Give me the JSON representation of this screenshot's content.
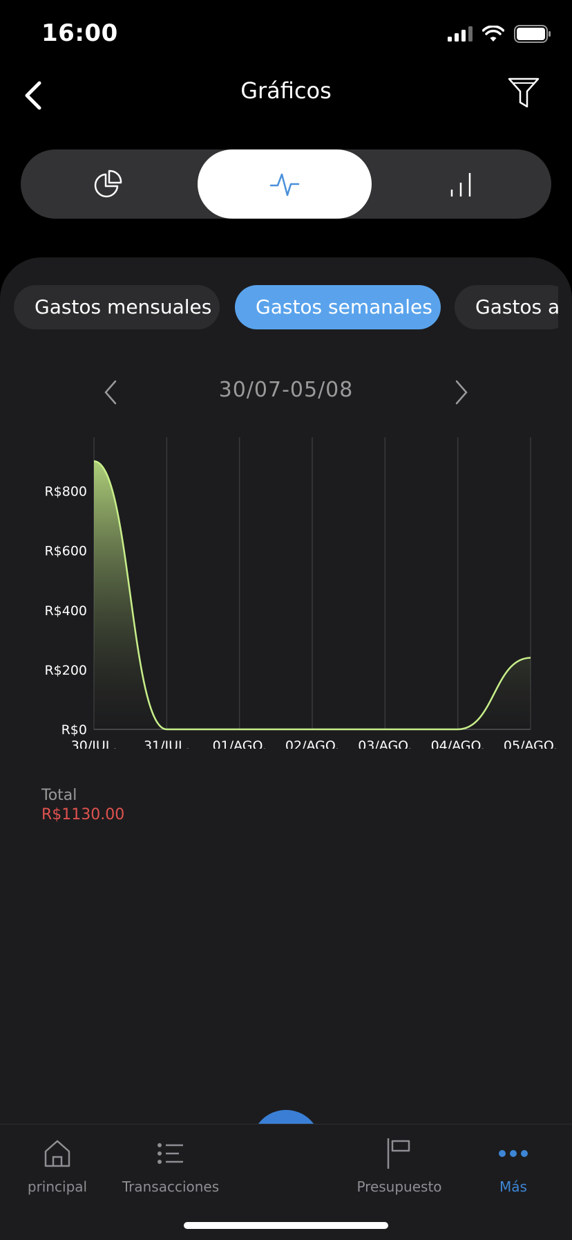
{
  "status_bar": {
    "time": "16:00"
  },
  "nav": {
    "title": "Gráficos"
  },
  "view_segments": [
    {
      "icon": "pie-chart-icon",
      "selected": false
    },
    {
      "icon": "line-chart-icon",
      "selected": true
    },
    {
      "icon": "bar-chart-icon",
      "selected": false
    }
  ],
  "chips": [
    {
      "label": "Gastos mensuales",
      "selected": false
    },
    {
      "label": "Gastos semanales",
      "selected": true
    },
    {
      "label": "Gastos anuales",
      "selected": false
    }
  ],
  "chips_visible": {
    "third": "Gastos ar"
  },
  "week": {
    "label": "30/07-05/08"
  },
  "chart_data": {
    "type": "area",
    "x": [
      "30/JUL.",
      "31/JUL.",
      "01/AGO.",
      "02/AGO.",
      "03/AGO.",
      "04/AGO.",
      "05/AGO."
    ],
    "series": [
      {
        "values": [
          900,
          0,
          0,
          0,
          0,
          0,
          240
        ]
      }
    ],
    "y_ticks": [
      "R$0",
      "R$200",
      "R$400",
      "R$600",
      "R$800"
    ],
    "ylim": [
      0,
      980
    ],
    "grid": "vertical",
    "line_color": "#c8ef8a"
  },
  "summary": {
    "total_label": "Total",
    "total_value": "R$1130.00"
  },
  "tabbar": {
    "home": "principal",
    "transactions": "Transacciones",
    "budget": "Presupuesto",
    "more": "Más"
  },
  "colors": {
    "accent": "#5aa3ec",
    "fab": "#3a7fd5",
    "total": "#e0524f",
    "active_tab": "#3d86d6"
  }
}
